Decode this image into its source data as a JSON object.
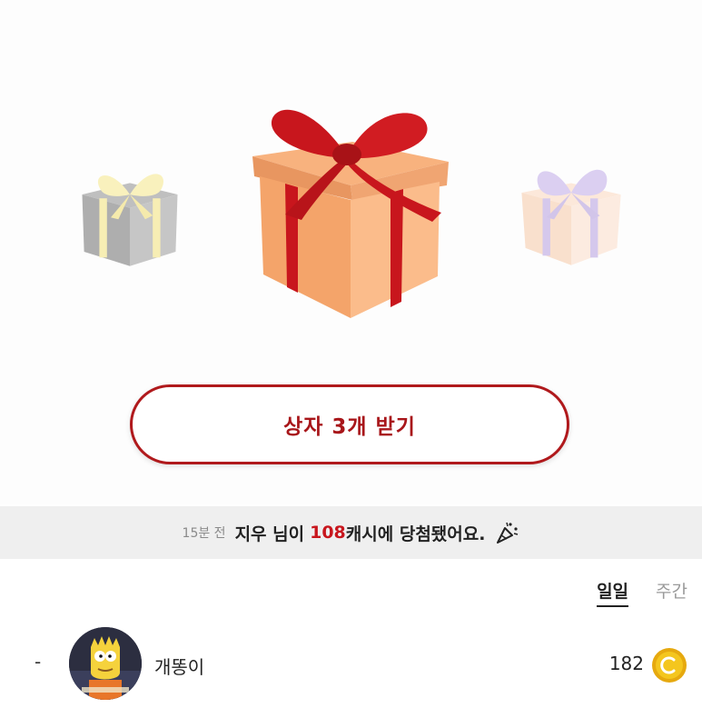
{
  "claim_button": {
    "label": "상자 3개 받기"
  },
  "ticker": {
    "time": "15분 전",
    "name": "지우 님이",
    "amount": "108",
    "message": "캐시에 당첨됐어요."
  },
  "tabs": [
    {
      "label": "일일",
      "active": true
    },
    {
      "label": "주간",
      "active": false
    }
  ],
  "ranking": [
    {
      "rank": "-",
      "name": "개똥이",
      "score": "182"
    }
  ],
  "colors": {
    "accent": "#b0191c",
    "highlight": "#c8161d",
    "coin": "#f2c21a"
  },
  "icons": [
    "gift-box-left-icon",
    "gift-box-center-icon",
    "gift-box-right-icon",
    "party-popper-icon",
    "coin-icon"
  ]
}
